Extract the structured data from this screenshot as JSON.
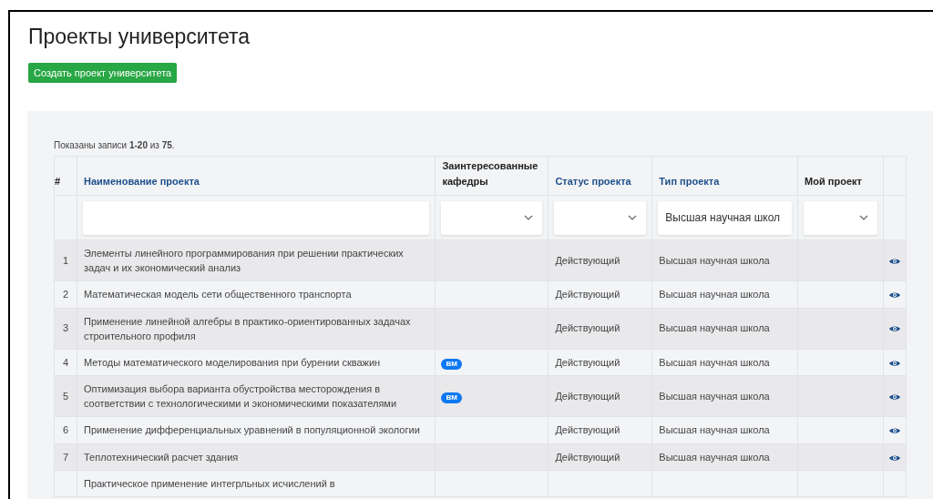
{
  "page": {
    "title": "Проекты университета",
    "create_button": "Создать проект университета"
  },
  "summary": "Показаны записи **1-20** из **75**.",
  "table": {
    "columns": [
      {
        "label": "#",
        "sortable": false
      },
      {
        "label": "Наименование проекта",
        "sortable": true
      },
      {
        "label": "Заинтересованные кафедры",
        "sortable": false
      },
      {
        "label": "Статус проекта",
        "sortable": true
      },
      {
        "label": "Тип проекта",
        "sortable": true
      },
      {
        "label": "Мой проект",
        "sortable": false
      }
    ],
    "filters": [
      {
        "kind": "none"
      },
      {
        "kind": "text"
      },
      {
        "kind": "select"
      },
      {
        "kind": "select"
      },
      {
        "kind": "text",
        "value": "Высшая научная школ"
      },
      {
        "kind": "select"
      }
    ],
    "rows": [
      {
        "number": "1",
        "name": "Элементы линейного программирования при решении практических задач и их экономический анализ",
        "departments": [],
        "status": "Действующий",
        "type": "Высшая научная школа"
      },
      {
        "number": "2",
        "name": "Математическая модель сети общественного транспорта",
        "departments": [],
        "status": "Действующий",
        "type": "Высшая научная школа"
      },
      {
        "number": "3",
        "name": "Применение линейной алгебры в практико-ориентированных задачах строительного профиля",
        "departments": [],
        "status": "Действующий",
        "type": "Высшая научная школа"
      },
      {
        "number": "4",
        "name": "Методы математического моделирования при бурении скважин",
        "departments": [
          "ВМ"
        ],
        "status": "Действующий",
        "type": "Высшая научная школа"
      },
      {
        "number": "5",
        "name": "Оптимизация выбора варианта обустройства месторождения в соответствии с технологическими и экономическими показателями",
        "departments": [
          "ВМ"
        ],
        "status": "Действующий",
        "type": "Высшая научная школа"
      },
      {
        "number": "6",
        "name": "Применение дифференциальных уравнений в популяционной экологии",
        "departments": [],
        "status": "Действующий",
        "type": "Высшая научная школа"
      },
      {
        "number": "7",
        "name": "Теплотехнический расчет здания",
        "departments": [],
        "status": "Действующий",
        "type": "Высшая научная школа"
      },
      {
        "name": "Практическое применение интегрльных исчислений в",
        "departments": []
      }
    ]
  }
}
